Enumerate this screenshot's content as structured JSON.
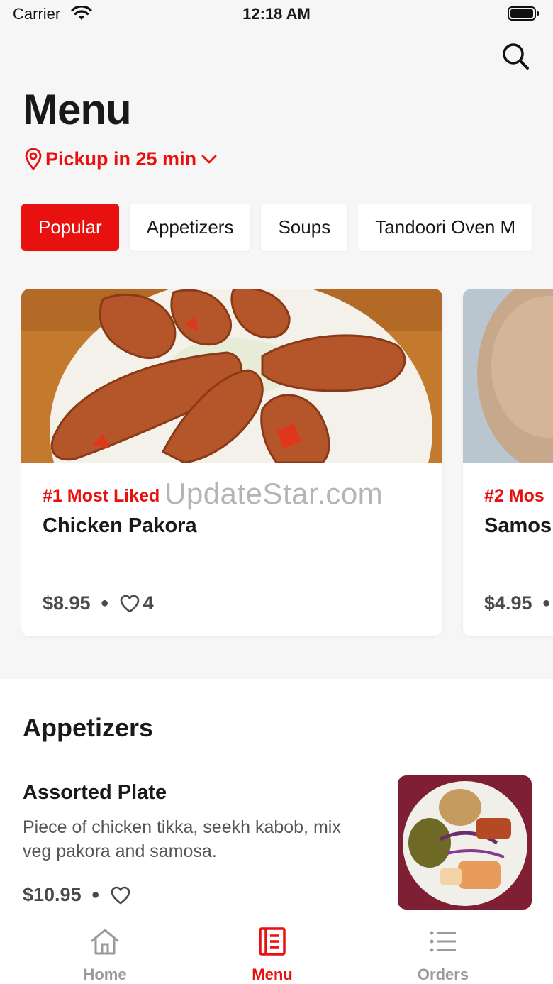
{
  "status": {
    "carrier": "Carrier",
    "time": "12:18 AM"
  },
  "header": {
    "title": "Menu",
    "pickup": "Pickup in 25 min"
  },
  "categories": [
    {
      "label": "Popular",
      "active": true
    },
    {
      "label": "Appetizers",
      "active": false
    },
    {
      "label": "Soups",
      "active": false
    },
    {
      "label": "Tandoori Oven M",
      "active": false
    }
  ],
  "popular": [
    {
      "badge": "#1 Most Liked",
      "name": "Chicken Pakora",
      "price": "$8.95",
      "likes": "4"
    },
    {
      "badge": "#2 Mos",
      "name": "Samos",
      "price": "$4.95",
      "likes": ""
    }
  ],
  "watermark": "UpdateStar.com",
  "section": {
    "title": "Appetizers",
    "item": {
      "name": "Assorted Plate",
      "description": "Piece of chicken tikka, seekh kabob, mix veg pakora and samosa.",
      "price": "$10.95"
    }
  },
  "tabs": [
    {
      "label": "Home",
      "icon": "home-icon",
      "active": false
    },
    {
      "label": "Menu",
      "icon": "menu-icon",
      "active": true
    },
    {
      "label": "Orders",
      "icon": "orders-icon",
      "active": false
    }
  ],
  "colors": {
    "accent": "#e8110f",
    "background": "#f6f6f6",
    "muted": "#9a9a9a"
  }
}
